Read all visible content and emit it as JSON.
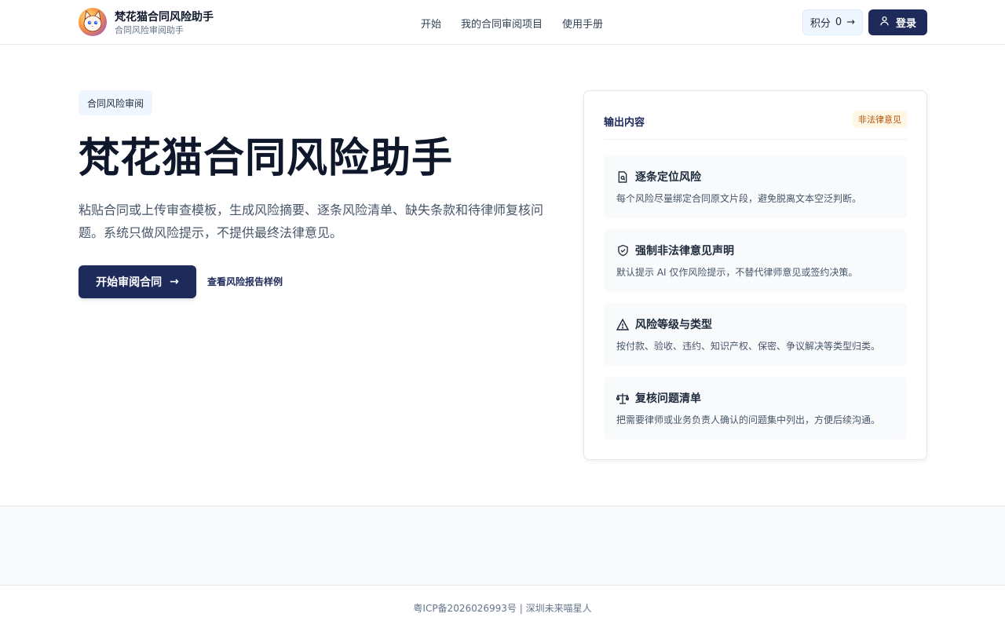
{
  "header": {
    "brand_title": "梵花猫合同风险助手",
    "brand_subtitle": "合同风险审阅助手",
    "nav": [
      {
        "label": "开始"
      },
      {
        "label": "我的合同审阅项目"
      },
      {
        "label": "使用手册"
      }
    ],
    "points_label": "积分",
    "points_value": "0",
    "points_arrow": "→",
    "login_label": "登录"
  },
  "hero": {
    "tag": "合同风险审阅",
    "title": "梵花猫合同风险助手",
    "description": "粘贴合同或上传审查模板，生成风险摘要、逐条风险清单、缺失条款和待律师复核问题。系统只做风险提示，不提供最终法律意见。",
    "cta_label": "开始审阅合同",
    "cta_arrow": "→",
    "sample_link": "查看风险报告样例"
  },
  "card": {
    "title": "输出内容",
    "badge": "非法律意见",
    "features": [
      {
        "icon": "document-search-icon",
        "title": "逐条定位风险",
        "desc": "每个风险尽量绑定合同原文片段，避免脱离文本空泛判断。"
      },
      {
        "icon": "shield-check-icon",
        "title": "强制非法律意见声明",
        "desc": "默认提示 AI 仅作风险提示，不替代律师意见或签约决策。"
      },
      {
        "icon": "warning-triangle-icon",
        "title": "风险等级与类型",
        "desc": "按付款、验收、违约、知识产权、保密、争议解决等类型归类。"
      },
      {
        "icon": "scale-icon",
        "title": "复核问题清单",
        "desc": "把需要律师或业务负责人确认的问题集中列出，方便后续沟通。"
      }
    ]
  },
  "footer": {
    "text": "粤ICP备2026026993号 | 深圳未来喵星人"
  },
  "colors": {
    "primary": "#1e2a5a",
    "badge_text": "#b45309",
    "badge_bg": "#fff7e6",
    "tag_bg": "#eff6ff"
  }
}
